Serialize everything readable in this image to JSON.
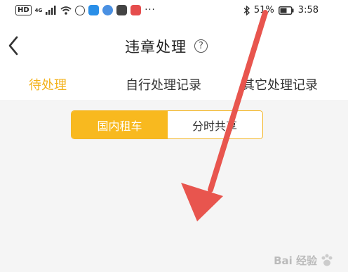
{
  "status_bar": {
    "hd_label": "HD",
    "network_label": "4G",
    "battery_percent": "51%",
    "time": "3:58",
    "overflow": "···",
    "icons": [
      "signal-icon",
      "wifi-icon",
      "app-icon",
      "cloud-app-icon",
      "music-app-icon",
      "mail-app-icon",
      "video-app-icon",
      "bluetooth-icon",
      "battery-icon"
    ]
  },
  "header": {
    "title": "违章处理",
    "help_symbol": "?"
  },
  "tabs": [
    {
      "label": "待处理",
      "active": true
    },
    {
      "label": "自行处理记录",
      "active": false
    },
    {
      "label": "其它处理记录",
      "active": false
    }
  ],
  "segment": {
    "options": [
      {
        "label": "国内租车",
        "active": true
      },
      {
        "label": "分时共享",
        "active": false
      }
    ]
  },
  "watermark": {
    "text": "Bai 经验"
  },
  "colors": {
    "accent": "#f8b91f",
    "arrow": "#e8554e",
    "background": "#f5f5f5"
  }
}
